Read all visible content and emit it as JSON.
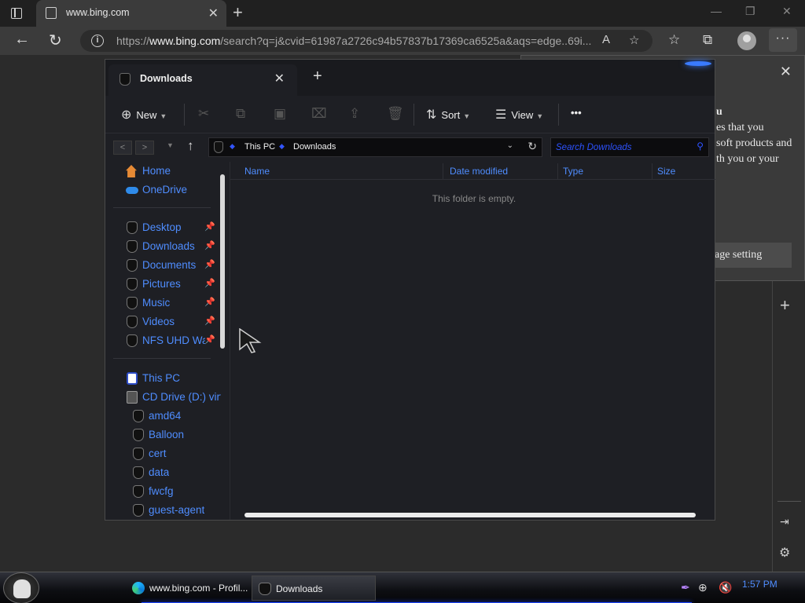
{
  "browser": {
    "tab_title": "www.bing.com",
    "url_prefix": "https://",
    "url_host": "www.bing.com",
    "url_rest": "/search?q=j&cvid=61987a2726c94b57837b17369ca6525a&aqs=edge..69i..."
  },
  "flyout": {
    "text_lines": [
      "u",
      "es that you",
      "soft products and",
      "th you or your"
    ],
    "button_label": "age setting"
  },
  "explorer": {
    "tab_title": "Downloads",
    "commands": {
      "new_label": "New",
      "sort_label": "Sort",
      "view_label": "View",
      "more_label": "•••"
    },
    "breadcrumb": [
      "This PC",
      "Downloads"
    ],
    "search_placeholder": "Search Downloads",
    "nav_items": [
      {
        "label": "Home",
        "icon": "home-icon"
      },
      {
        "label": "OneDrive",
        "icon": "onedrive-icon"
      },
      {
        "label": "Desktop",
        "icon": "desktop-icon",
        "pinned": true
      },
      {
        "label": "Downloads",
        "icon": "downloads-icon",
        "pinned": true
      },
      {
        "label": "Documents",
        "icon": "documents-icon",
        "pinned": true
      },
      {
        "label": "Pictures",
        "icon": "pictures-icon",
        "pinned": true
      },
      {
        "label": "Music",
        "icon": "music-icon",
        "pinned": true
      },
      {
        "label": "Videos",
        "icon": "videos-icon",
        "pinned": true
      },
      {
        "label": "NFS UHD Wa",
        "icon": "folder-icon",
        "pinned": true
      },
      {
        "label": "This PC",
        "icon": "this-pc-icon"
      },
      {
        "label": "CD Drive (D:) virt",
        "icon": "cd-drive-icon"
      },
      {
        "label": "amd64",
        "icon": "folder-icon"
      },
      {
        "label": "Balloon",
        "icon": "folder-icon"
      },
      {
        "label": "cert",
        "icon": "folder-icon"
      },
      {
        "label": "data",
        "icon": "folder-icon"
      },
      {
        "label": "fwcfg",
        "icon": "folder-icon"
      },
      {
        "label": "guest-agent",
        "icon": "folder-icon"
      }
    ],
    "columns": [
      "Name",
      "Date modified",
      "Type",
      "Size"
    ],
    "empty_message": "This folder is empty."
  },
  "taskbar": {
    "items": [
      {
        "label": "www.bing.com - Profil...",
        "icon": "edge-icon"
      },
      {
        "label": "Downloads",
        "icon": "explorer-icon"
      }
    ],
    "clock": "1:57 PM"
  },
  "colors": {
    "accent_blue": "#4f8dff",
    "search_blue": "#2d52ff",
    "taskbar_glow": "#1d46ff"
  }
}
